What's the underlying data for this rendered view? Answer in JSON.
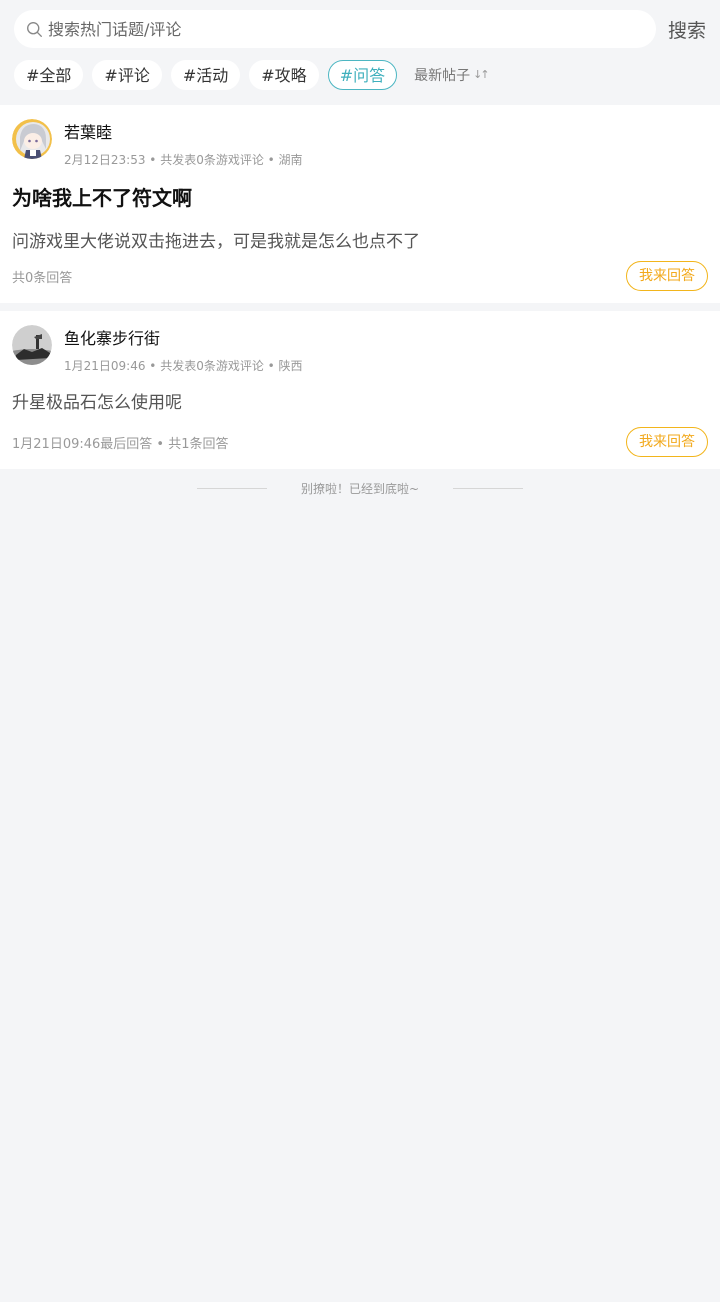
{
  "search": {
    "placeholder": "搜索热门话题/评论",
    "button_label": "搜索"
  },
  "tags": [
    {
      "label": "#全部",
      "active": false
    },
    {
      "label": "#评论",
      "active": false
    },
    {
      "label": "#活动",
      "active": false
    },
    {
      "label": "#攻略",
      "active": false
    },
    {
      "label": "#问答",
      "active": true
    }
  ],
  "sort": {
    "label": "最新帖子",
    "icon": "sort-arrows-icon"
  },
  "posts": [
    {
      "author": "若葉睦",
      "meta": "2月12日23:53 • 共发表0条游戏评论 • 湖南",
      "title": "为啥我上不了符文啊",
      "body": "问游戏里大佬说双击拖进去，可是我就是怎么也点不了",
      "footer": "共0条回答",
      "answer_label": "我来回答"
    },
    {
      "author": "鱼化寨步行街",
      "meta": "1月21日09:46 • 共发表0条游戏评论 • 陕西",
      "title": "",
      "body": "升星极品石怎么使用呢",
      "footer": "1月21日09:46最后回答 • 共1条回答",
      "answer_label": "我来回答"
    }
  ],
  "end_text": "别撩啦！已经到底啦~",
  "colors": {
    "accent_teal": "#3fb0bd",
    "answer_orange": "#f2a91c",
    "background": "#f4f5f7"
  }
}
